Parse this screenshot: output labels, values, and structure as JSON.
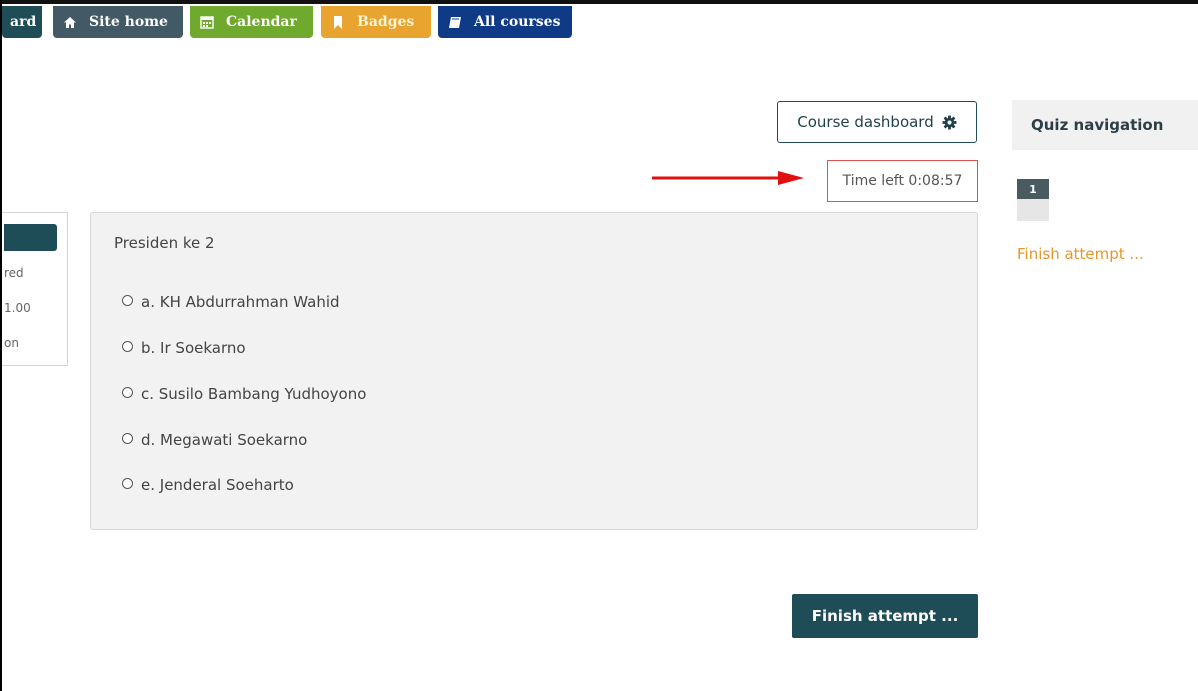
{
  "nav": {
    "dashboard_label": "ard",
    "site_home_label": "Site home",
    "calendar_label": "Calendar",
    "badges_label": "Badges",
    "all_courses_label": "All courses"
  },
  "course_dashboard": {
    "label": "Course dashboard",
    "icon": "gear-icon"
  },
  "timer": {
    "text": "Time left 0:08:57"
  },
  "info_box": {
    "lines": [
      "red",
      "1.00",
      "on"
    ]
  },
  "question": {
    "text": "Presiden ke 2",
    "answers": [
      "a. KH Abdurrahman Wahid",
      "b. Ir Soekarno",
      "c. Susilo Bambang Yudhoyono",
      "d. Megawati Soekarno",
      "e. Jenderal Soeharto"
    ]
  },
  "finish_button": {
    "label": "Finish attempt ..."
  },
  "quiz_navigation": {
    "title": "Quiz navigation",
    "questions": [
      "1"
    ],
    "finish_link": "Finish attempt ..."
  },
  "colors": {
    "primary": "#1f4d57",
    "timer_border": "#d9534f",
    "arrow": "#e01010",
    "finish_link": "#e8952b"
  }
}
